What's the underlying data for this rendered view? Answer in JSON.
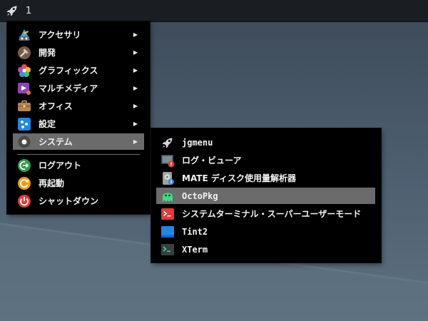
{
  "taskbar": {
    "launcher_icon": "rocket-icon",
    "workspace_label": "1"
  },
  "main_menu": {
    "items": [
      {
        "label": "アクセサリ",
        "icon": "accessories-icon",
        "has_submenu": true
      },
      {
        "label": "開発",
        "icon": "development-icon",
        "has_submenu": true
      },
      {
        "label": "グラフィックス",
        "icon": "graphics-icon",
        "has_submenu": true
      },
      {
        "label": "マルチメディア",
        "icon": "multimedia-icon",
        "has_submenu": true
      },
      {
        "label": "オフィス",
        "icon": "office-icon",
        "has_submenu": true
      },
      {
        "label": "設定",
        "icon": "settings-icon",
        "has_submenu": true
      },
      {
        "label": "システム",
        "icon": "system-icon",
        "has_submenu": true,
        "selected": true
      },
      {
        "label": "ログアウト",
        "icon": "logout-icon",
        "has_submenu": false
      },
      {
        "label": "再起動",
        "icon": "reboot-icon",
        "has_submenu": false
      },
      {
        "label": "シャットダウン",
        "icon": "shutdown-icon",
        "has_submenu": false
      }
    ],
    "arrow_glyph": "▶"
  },
  "system_submenu": {
    "items": [
      {
        "label": "jgmenu",
        "icon": "rocket-icon"
      },
      {
        "label": "ログ・ビューア",
        "icon": "log-viewer-icon"
      },
      {
        "label": "MATE ディスク使用量解析器",
        "icon": "disk-usage-icon"
      },
      {
        "label": "OctoPkg",
        "icon": "octopkg-icon",
        "selected": true
      },
      {
        "label": "システムターミナル・スーパーユーザーモード",
        "icon": "root-terminal-icon"
      },
      {
        "label": "Tint2",
        "icon": "tint2-icon"
      },
      {
        "label": "XTerm",
        "icon": "xterm-icon"
      }
    ]
  },
  "colors": {
    "menu_bg": "#000000",
    "selected_bg": "#6b6b6b",
    "taskbar_bg": "#1a1e22",
    "desktop": "#4d5f70"
  }
}
